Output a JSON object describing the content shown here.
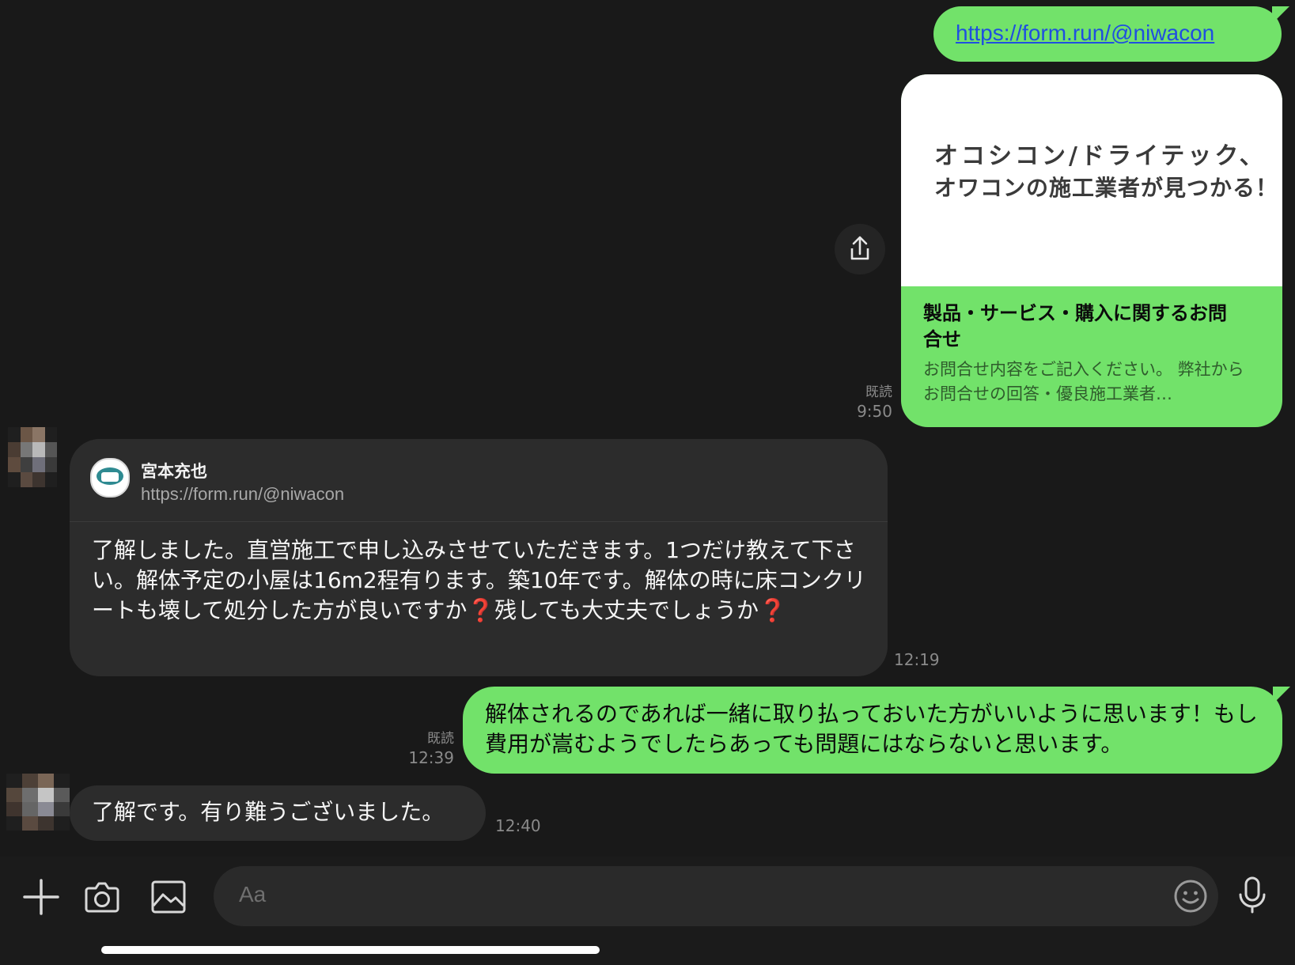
{
  "messages": {
    "m1": {
      "link": "https://form.run/@niwacon"
    },
    "m2": {
      "preview_banner_line1": "オコシコン/ドライテック、",
      "preview_banner_line2": "オワコンの施工業者が見つかる！",
      "card_title": "製品・サービス・購入に関するお問合せ",
      "card_desc": "お問合せ内容をご記入ください。 弊社からお問合せの回答・優良施工業者…",
      "read": "既読",
      "time": "9:50"
    },
    "m3": {
      "sender": "宮本充也",
      "quoted_url": "https://form.run/@niwacon",
      "text": "了解しました。直営施工で申し込みさせていただきます。1つだけ教えて下さい。解体予定の小屋は16m2程有ります。築10年です。解体の時に床コンクリートも壊して処分した方が良いですか❓残しても大丈夫でしょうか❓",
      "time": "12:19"
    },
    "m4": {
      "text": "解体されるのであれば一緒に取り払っておいた方がいいように思います！もし費用が嵩むようでしたらあっても問題にはならないと思います。",
      "read": "既読",
      "time": "12:39"
    },
    "m5": {
      "text": "了解です。有り難うございました。",
      "time": "12:40"
    }
  },
  "input": {
    "placeholder": "Aa"
  },
  "icons": {
    "share": "share-icon",
    "plus": "plus-icon",
    "camera": "camera-icon",
    "image": "image-icon",
    "emoji": "emoji-icon",
    "mic": "microphone-icon"
  },
  "colors": {
    "accent_green": "#72e26a",
    "background": "#191919",
    "incoming_bubble": "#2c2c2c",
    "link_blue": "#1f4fe0"
  }
}
